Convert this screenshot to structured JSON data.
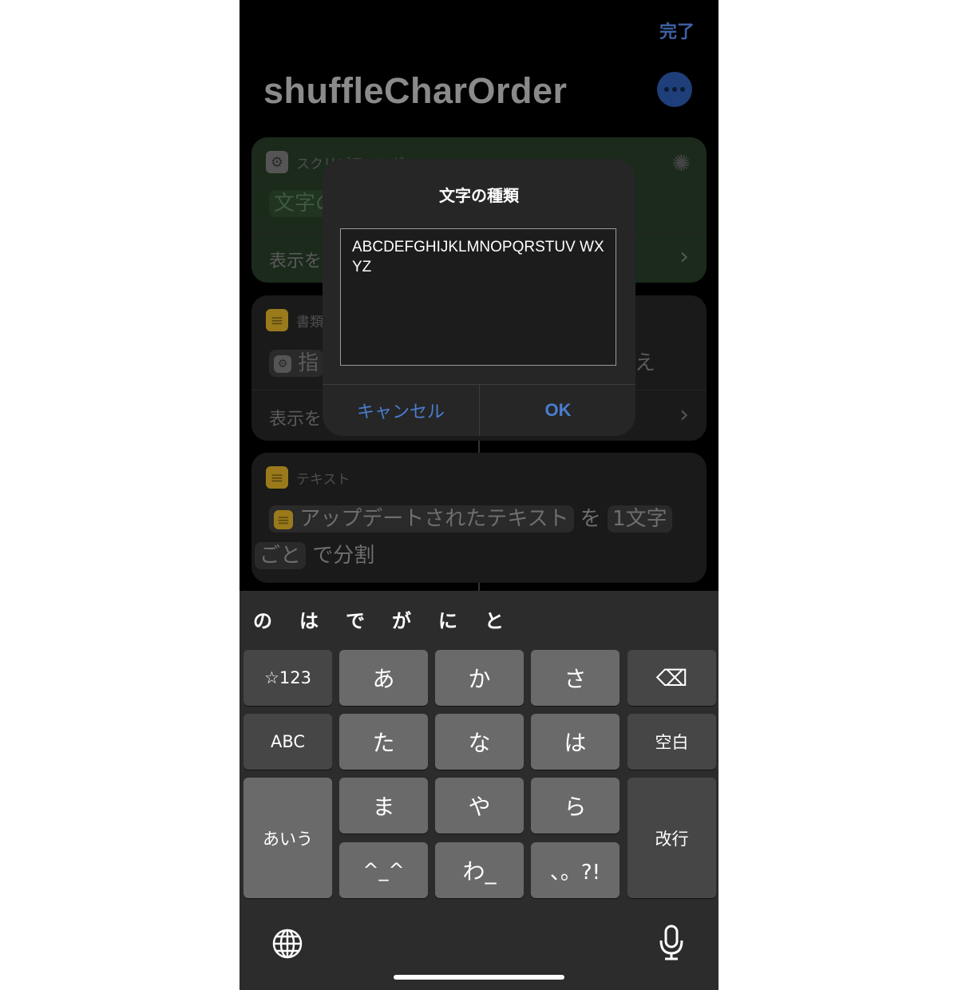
{
  "nav": {
    "done_label": "完了"
  },
  "page_title": "shuffleCharOrder",
  "cards": {
    "script": {
      "header": "スクリプティング",
      "row1": "文字の",
      "row2": "表示を"
    },
    "doc": {
      "header": "書類",
      "row1_tag": "指",
      "row1_tail": "え",
      "row2": "表示を"
    },
    "text": {
      "header": "テキスト",
      "line1_tag": "アップデートされたテキスト",
      "line1_mid": "を",
      "line1_tag2": "1文字",
      "line2_tag": "ごと",
      "line2_tail": "で分割"
    }
  },
  "alert": {
    "title": "文字の種類",
    "input_value": "ABCDEFGHIJKLMNOPQRSTUV WXYZ",
    "cancel_label": "キャンセル",
    "ok_label": "OK"
  },
  "keyboard": {
    "candidates": [
      "の",
      "は",
      "で",
      "が",
      "に",
      "と"
    ],
    "keys": {
      "sym": "☆123",
      "a": "あ",
      "ka": "か",
      "sa": "さ",
      "del": "⌫",
      "abc": "ABC",
      "ta": "た",
      "na": "な",
      "ha": "は",
      "space": "空白",
      "aiu": "あいう",
      "ma": "ま",
      "ya": "や",
      "ra": "ら",
      "enter": "改行",
      "kao": "^_^",
      "wa": "わ_",
      "punct": "、。?!"
    }
  },
  "colors": {
    "accent": "#4a7ccf",
    "background": "#000000",
    "key": "#6a6a6a",
    "fn_key": "#464646"
  }
}
